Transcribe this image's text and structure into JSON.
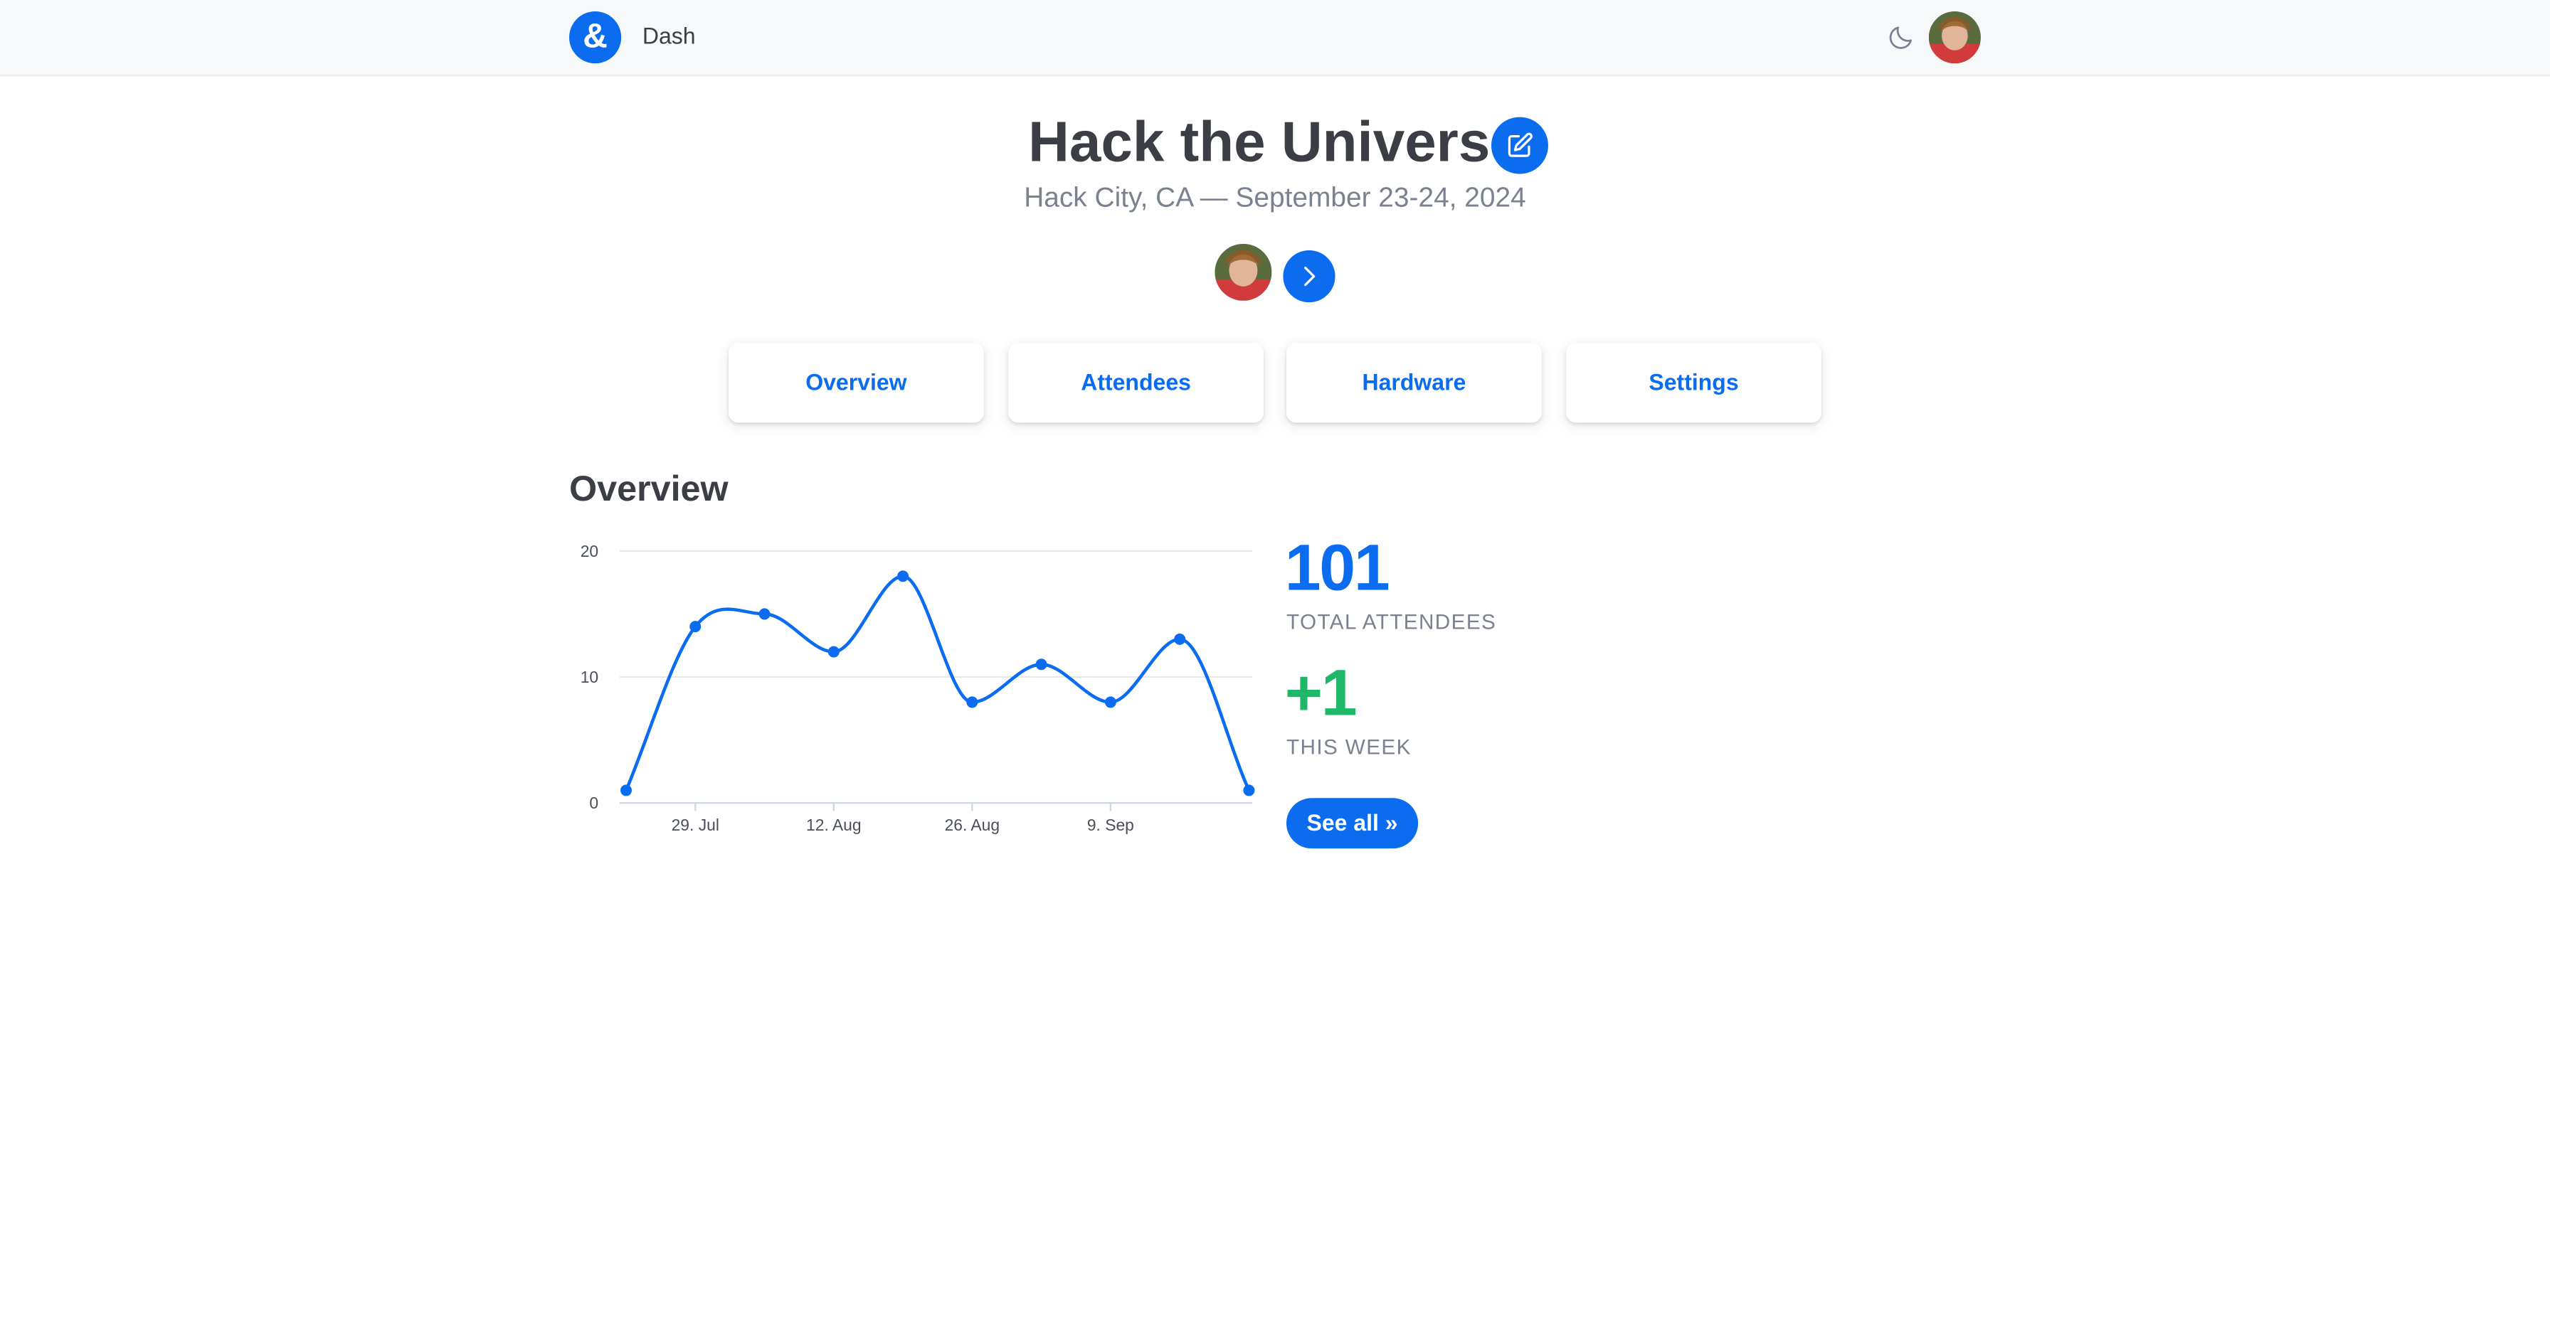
{
  "navbar": {
    "logo": "&",
    "title": "Dash",
    "theme_icon": "moon-icon",
    "user_avatar": "avatar"
  },
  "event": {
    "title": "Hack the Universe",
    "subtitle": "Hack City, CA — September 23-24, 2024",
    "edit_icon": "edit-icon",
    "next_icon": "chevron-right-icon"
  },
  "tabs": [
    {
      "label": "Overview"
    },
    {
      "label": "Attendees"
    },
    {
      "label": "Hardware"
    },
    {
      "label": "Settings"
    }
  ],
  "overview": {
    "title": "Overview",
    "total_value": "101",
    "total_label": "TOTAL ATTENDEES",
    "week_value": "+1",
    "week_label": "THIS WEEK",
    "see_all": "See all »"
  },
  "colors": {
    "accent": "#0b6cf0",
    "positive": "#1fb869",
    "muted": "#7a8190"
  },
  "chart_data": {
    "type": "line",
    "x": [
      "2024-07-22",
      "2024-07-29",
      "2024-08-05",
      "2024-08-12",
      "2024-08-19",
      "2024-08-26",
      "2024-09-02",
      "2024-09-09",
      "2024-09-16",
      "2024-09-23"
    ],
    "values": [
      1,
      14,
      15,
      12,
      18,
      8,
      11,
      8,
      13,
      1
    ],
    "ylim": [
      0,
      20
    ],
    "yticks": [
      "0",
      "10",
      "20"
    ],
    "xticks": [
      "29. Jul",
      "12. Aug",
      "26. Aug",
      "9. Sep"
    ],
    "grid": true,
    "xlabel": "",
    "ylabel": ""
  }
}
